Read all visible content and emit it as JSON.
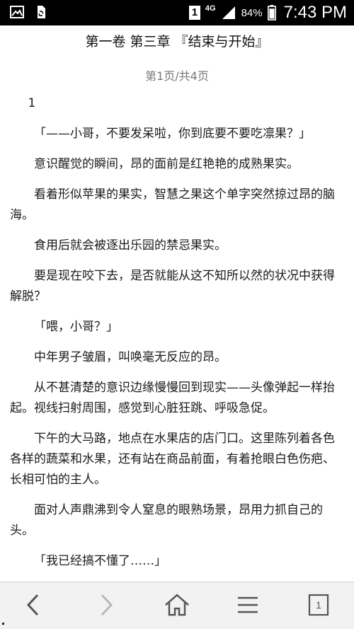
{
  "status_bar": {
    "sim_label": "1",
    "network": "4G",
    "battery": "84%",
    "time": "7:43 PM"
  },
  "reader": {
    "chapter_title": "第一卷 第三章 『结束与开始』",
    "page_indicator": "第1页/共4页",
    "paragraphs": [
      "1",
      "「——小哥，不要发呆啦，你到底要不要吃凛果？」",
      "意识醒觉的瞬间，昂的面前是红艳艳的成熟果实。",
      "看着形似苹果的果实，智慧之果这个单字突然掠过昂的脑海。",
      "食用后就会被逐出乐园的禁忌果实。",
      "要是现在咬下去，是否就能从这不知所以然的状况中获得解脱？",
      "「喂，小哥？」",
      "中年男子皱眉，叫唤毫无反应的昂。",
      "从不甚清楚的意识边缘慢慢回到现实——头像弹起一样抬起。视线扫射周围，感觉到心脏狂跳、呼吸急促。",
      "下午的大马路，地点在水果店的店门口。这里陈列着各色各样的蔬菜和水果，还有站在商品前面，有着抢眼白色伤疤、长相可怕的主人。",
      "面对人声鼎沸到令人窒息的眼熟场景，昂用力抓自己的头。",
      "「我已经搞不懂了……」"
    ]
  },
  "toolbar": {
    "tab_count": "1",
    "icons": [
      "back-icon",
      "forward-icon",
      "home-icon",
      "menu-icon",
      "tabs-icon"
    ]
  }
}
